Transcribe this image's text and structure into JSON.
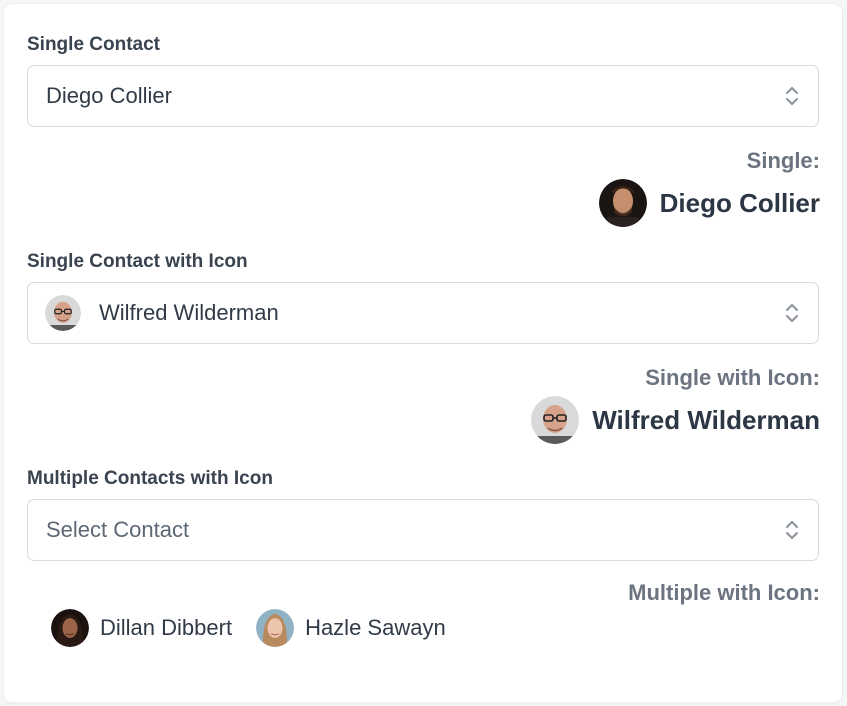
{
  "single": {
    "label": "Single Contact",
    "selected": "Diego Collier",
    "result_caption": "Single:",
    "result_name": "Diego Collier",
    "avatar_icon": "person-avatar-icon"
  },
  "single_icon": {
    "label": "Single Contact with Icon",
    "selected": "Wilfred Wilderman",
    "result_caption": "Single with Icon:",
    "result_name": "Wilfred Wilderman",
    "avatar_icon": "person-avatar-icon"
  },
  "multiple_icon": {
    "label": "Multiple Contacts with Icon",
    "placeholder": "Select Contact",
    "result_caption": "Multiple with Icon:",
    "selected": [
      {
        "name": "Dillan Dibbert",
        "avatar_icon": "person-avatar-icon"
      },
      {
        "name": "Hazle Sawayn",
        "avatar_icon": "person-avatar-icon"
      }
    ]
  },
  "colors": {
    "label": "#3a4350",
    "caption": "#6b7480",
    "border": "#d6dbe2",
    "text": "#313b48"
  }
}
